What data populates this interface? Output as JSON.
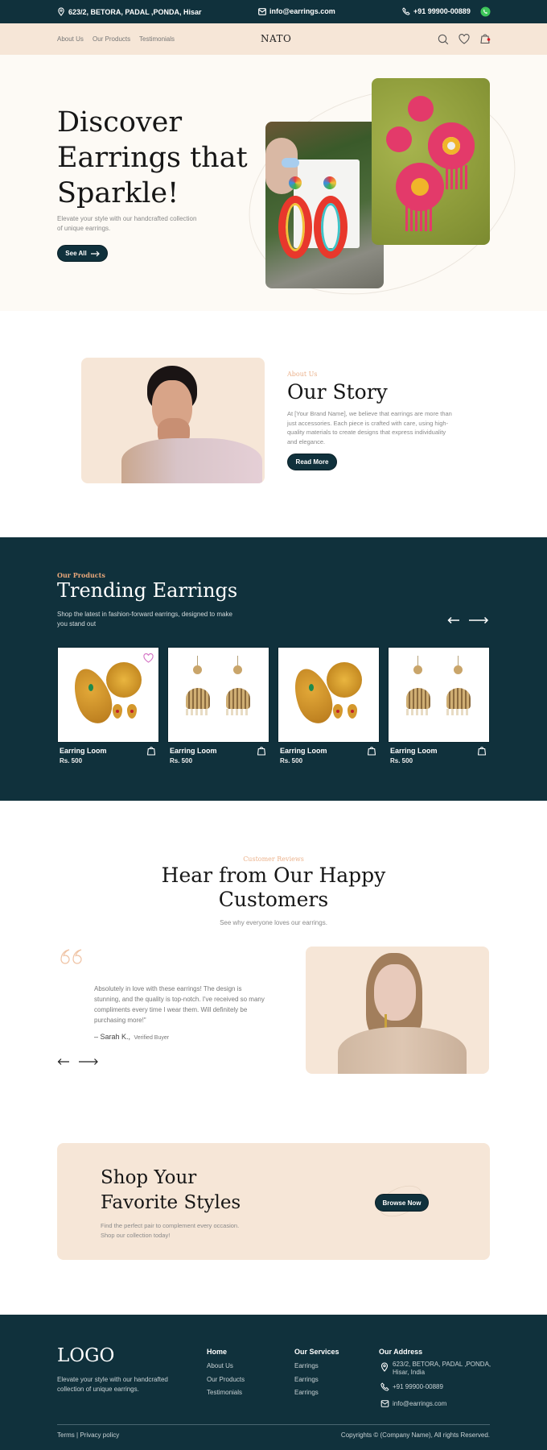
{
  "topbar": {
    "address": "623/2, BETORA, PADAL ,PONDA, Hisar",
    "email": "info@earrings.com",
    "phone": "+91 99900-00889"
  },
  "nav": {
    "links": [
      "About Us",
      "Our Products",
      "Testimonials"
    ],
    "brand": "NATO",
    "cart_badge_color": "#d4202a"
  },
  "hero": {
    "title_lines": [
      "Discover",
      "Earrings that",
      "Sparkle!"
    ],
    "subtitle_lines": [
      "Elevate your style with our handcrafted collection",
      "of unique earrings."
    ],
    "cta_label": "See All"
  },
  "story": {
    "eyebrow": "About Us",
    "title": "Our Story",
    "body_lines": [
      "At [Your Brand Name], we believe that earrings are more than",
      "just accessories. Each piece is crafted with care, using high-",
      "quality materials to create designs that express individuality",
      "and elegance."
    ],
    "cta_label": "Read More"
  },
  "products": {
    "eyebrow": "Our Products",
    "title": "Trending Earrings",
    "subtitle_lines": [
      "Shop the latest in fashion-forward earrings, designed to make",
      "you stand out"
    ],
    "items": [
      {
        "name": "Earring Loom",
        "price": "Rs. 500",
        "style": "gold-pendant",
        "wishlist": true
      },
      {
        "name": "Earring Loom",
        "price": "Rs. 500",
        "style": "jhumka",
        "wishlist": false
      },
      {
        "name": "Earring Loom",
        "price": "Rs. 500",
        "style": "gold-pendant",
        "wishlist": false
      },
      {
        "name": "Earring Loom",
        "price": "Rs. 500",
        "style": "jhumka",
        "wishlist": false
      }
    ]
  },
  "reviews": {
    "eyebrow": "Customer Reviews",
    "title_lines": [
      "Hear from Our Happy",
      "Customers"
    ],
    "subtitle": "See why everyone loves our earrings.",
    "quote_lines": [
      "Absolutely in love with these earrings! The design is",
      "stunning, and the quality is top-notch. I've received so many",
      "compliments every time I wear them. Will definitely be",
      "purchasing more!\""
    ],
    "author": "– Sarah K.,",
    "author_role": "Verified Buyer"
  },
  "cta_banner": {
    "title_lines": [
      "Shop Your",
      "Favorite Styles"
    ],
    "body_lines": [
      "Find the perfect pair to complement every occasion.",
      "Shop our collection today!"
    ],
    "button_label": "Browse Now"
  },
  "footer": {
    "logo": "LOGO",
    "tagline_lines": [
      "Elevate your style with our handcrafted",
      "collection of unique earrings."
    ],
    "col1": {
      "heading": "Home",
      "links": [
        "About Us",
        "Our Products",
        "Testimonials"
      ]
    },
    "col2": {
      "heading": "Our Services",
      "links": [
        "Earrings",
        "Earrings",
        "Earrings"
      ]
    },
    "col3": {
      "heading": "Our Address",
      "address_lines": [
        "623/2, BETORA, PADAL ,PONDA,",
        "Hisar, India"
      ],
      "phone": "+91 99900-00889",
      "email": "info@earrings.com"
    },
    "terms": "Terms",
    "separator": "|",
    "privacy": "Privacy policy",
    "copyright": "Copyrights © (Company Name), All rights Reserved."
  },
  "colors": {
    "primary_dark": "#10313c",
    "peach": "#f6e6d7",
    "accent": "#e8a77a",
    "cream": "#fdfaf5"
  }
}
